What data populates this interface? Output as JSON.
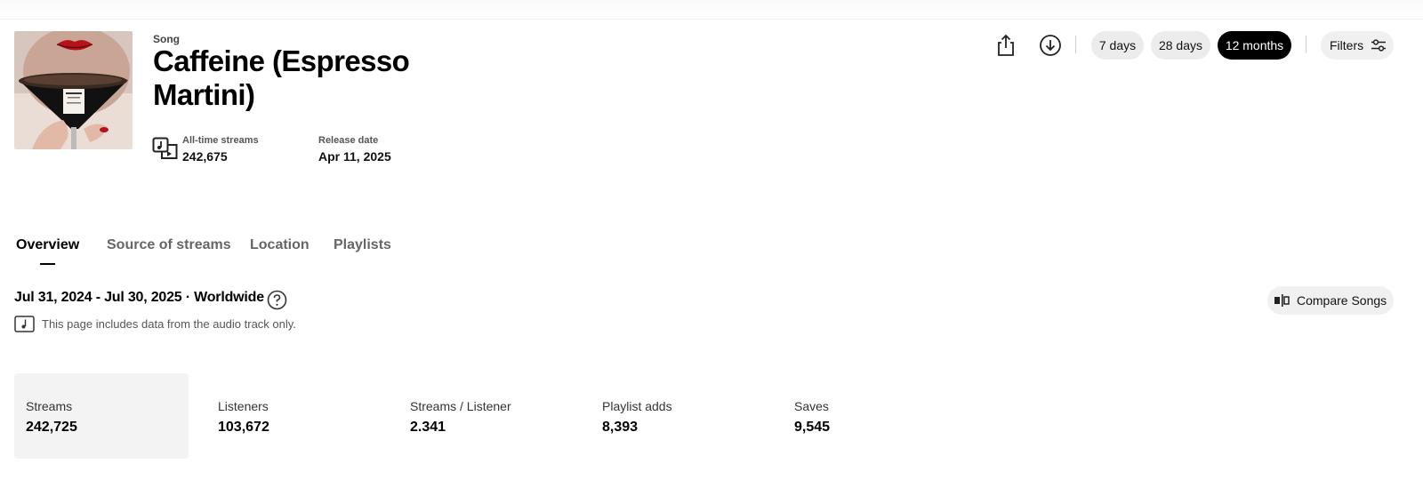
{
  "header": {
    "type_label": "Song",
    "title": "Caffeine (Espresso Martini)",
    "cover_icon": "album-cover-martini",
    "stats": [
      {
        "label": "All-time streams",
        "value": "242,675",
        "icon": "streams-icon"
      },
      {
        "label": "Release date",
        "value": "Apr 11, 2025"
      }
    ]
  },
  "toolbar": {
    "share_icon": "share-icon",
    "download_icon": "download-icon",
    "ranges": [
      {
        "label": "7 days",
        "active": false
      },
      {
        "label": "28 days",
        "active": false
      },
      {
        "label": "12 months",
        "active": true
      }
    ],
    "filters_label": "Filters",
    "filters_icon": "sliders-icon"
  },
  "tabs": [
    {
      "label": "Overview",
      "active": true
    },
    {
      "label": "Source of streams",
      "active": false
    },
    {
      "label": "Location",
      "active": false
    },
    {
      "label": "Playlists",
      "active": false
    }
  ],
  "range_info": {
    "text": "Jul 31, 2024 - Jul 30, 2025 · Worldwide",
    "help_icon": "help-icon",
    "note": "This page includes data from the audio track only.",
    "note_icon": "audio-track-icon"
  },
  "compare": {
    "label": "Compare Songs",
    "icon": "compare-icon"
  },
  "metrics": [
    {
      "label": "Streams",
      "value": "242,725",
      "active": true
    },
    {
      "label": "Listeners",
      "value": "103,672",
      "active": false
    },
    {
      "label": "Streams / Listener",
      "value": "2.341",
      "active": false
    },
    {
      "label": "Playlist adds",
      "value": "8,393",
      "active": false
    },
    {
      "label": "Saves",
      "value": "9,545",
      "active": false
    }
  ],
  "colors": {
    "accent": "#000000",
    "pill_bg": "#ececec",
    "metric_active_bg": "#f3f3f3"
  }
}
